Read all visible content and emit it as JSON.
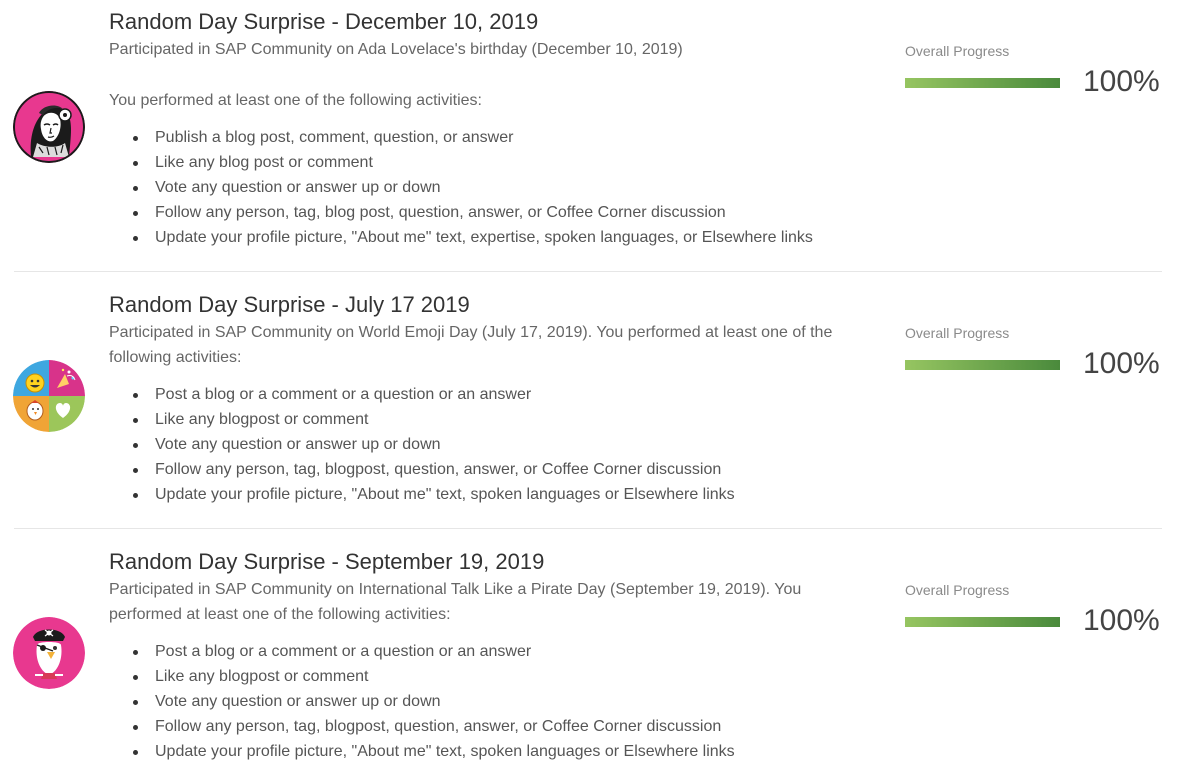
{
  "badges": [
    {
      "title": "Random Day Surprise - December 10, 2019",
      "description": "Participated in SAP Community on Ada Lovelace's birthday (December 10, 2019)",
      "intro": "You performed at least one of the following activities:",
      "activities": [
        "Publish a blog post, comment, question, or answer",
        "Like any blog post or comment",
        "Vote any question or answer up or down",
        "Follow any person, tag, blog post, question, answer, or Coffee Corner discussion",
        "Update your profile picture, \"About me\" text, expertise, spoken languages, or Elsewhere links"
      ],
      "icon": "ada-lovelace-portrait-icon",
      "progress_label": "Overall Progress",
      "progress_value": 100,
      "progress_text": "100%"
    },
    {
      "title": "Random Day Surprise - July 17 2019",
      "description": "Participated in SAP Community on World Emoji Day (July 17, 2019). You performed at least one of the following activities:",
      "intro": "",
      "activities": [
        "Post a blog or a comment or a question or an answer",
        "Like any blogpost or comment",
        "Vote any question or answer up or down",
        "Follow any person, tag, blogpost, question, answer, or Coffee Corner discussion",
        "Update your profile picture, \"About me\" text, spoken languages or Elsewhere links"
      ],
      "icon": "emoji-quadrant-icon",
      "progress_label": "Overall Progress",
      "progress_value": 100,
      "progress_text": "100%"
    },
    {
      "title": "Random Day Surprise - September 19, 2019",
      "description": "Participated in SAP Community on International Talk Like a Pirate Day (September 19, 2019). You performed at least one of the following activities:",
      "intro": "",
      "activities": [
        "Post a blog or a comment or a question or an answer",
        "Like any blogpost or comment",
        "Vote any question or answer up or down",
        "Follow any person, tag, blogpost, question, answer, or Coffee Corner discussion",
        "Update your profile picture, \"About me\" text, spoken languages or Elsewhere links"
      ],
      "icon": "pirate-parrot-icon",
      "progress_label": "Overall Progress",
      "progress_value": 100,
      "progress_text": "100%"
    }
  ],
  "colors": {
    "progress_start": "#96c561",
    "progress_end": "#4a8a3c",
    "badge_pink": "#e8388f",
    "divider": "#e6e6e6"
  }
}
